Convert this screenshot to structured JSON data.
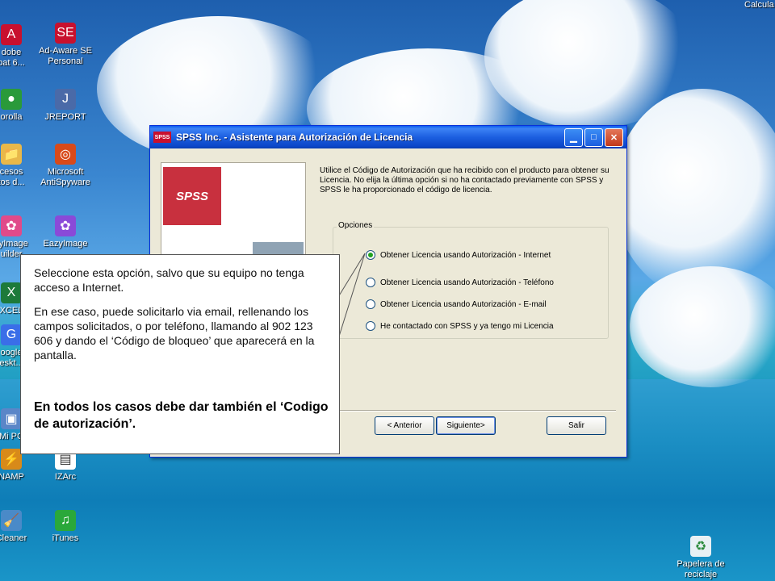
{
  "desktop": {
    "top_right_label": "Calcula",
    "icons_left": [
      {
        "name": "adobe-acrobat-icon",
        "label": "Adobe\nAcrobat 6...",
        "lines": [
          "dobe",
          "bat 6..."
        ],
        "glyph": "A",
        "color": "#c8102e"
      },
      {
        "name": "corolla-icon",
        "lines": [
          "orolla"
        ],
        "glyph": "●",
        "color": "#2a9a3a"
      },
      {
        "name": "accesos-folder-icon",
        "lines": [
          "cesos",
          "tos d..."
        ],
        "glyph": "📁",
        "color": "#e8b84a"
      },
      {
        "name": "eazyimage-builder-icon",
        "lines": [
          "zyImage",
          "uilder"
        ],
        "glyph": "✿",
        "color": "#e04a8a"
      },
      {
        "name": "excel-icon",
        "lines": [
          "XCEL"
        ],
        "glyph": "X",
        "color": "#1d7a3a"
      },
      {
        "name": "google-desktop-icon",
        "lines": [
          "oogle",
          "eskt..."
        ],
        "glyph": "G",
        "color": "#3a6ee8"
      },
      {
        "name": "mi-pc-icon",
        "lines": [
          "Mi PC"
        ],
        "glyph": "▣",
        "color": "#5a86c8"
      },
      {
        "name": "winamp-icon",
        "lines": [
          "NAMP"
        ],
        "glyph": "⚡",
        "color": "#d88a1a"
      },
      {
        "name": "cleaner-icon",
        "lines": [
          "Cleaner"
        ],
        "glyph": "🧹",
        "color": "#4a8ac8"
      }
    ],
    "icons_right": [
      {
        "name": "ad-aware-icon",
        "lines": [
          "Ad-Aware SE",
          "Personal"
        ],
        "glyph": "SE",
        "color": "#c8102e"
      },
      {
        "name": "jreport-icon",
        "lines": [
          "JREPORT"
        ],
        "glyph": "J",
        "color": "#4a6aa8"
      },
      {
        "name": "antispyware-icon",
        "lines": [
          "Microsoft",
          "AntiSpyware"
        ],
        "glyph": "◎",
        "color": "#d84a1a"
      },
      {
        "name": "eazyimage-icon",
        "lines": [
          "EazyImage"
        ],
        "glyph": "✿",
        "color": "#8a4ad8"
      },
      {
        "name": "izarc-icon",
        "lines": [
          "IZArc"
        ],
        "glyph": "▤",
        "color": "#ffffff"
      },
      {
        "name": "itunes-icon",
        "lines": [
          "iTunes"
        ],
        "glyph": "♫",
        "color": "#2aa83a"
      }
    ],
    "recycle_bin": {
      "lines": [
        "Papelera de",
        "reciclaje"
      ]
    }
  },
  "window": {
    "title": "SPSS Inc. - Asistente para Autorización de Licencia",
    "title_icon_text": "SPSS",
    "logo_text": "SPSS",
    "intro_text": "Utilice el Código de Autorización que ha recibido con el producto para obtener su Licencia. No elija la última opción si no ha contactado previamente con SPSS y SPSS le ha proporcionado el código de licencia.",
    "group_label": "Opciones",
    "options": [
      {
        "label": "Obtener Licencia usando Autorización - Internet",
        "selected": true
      },
      {
        "label": "Obtener Licencia usando Autorización - Teléfono",
        "selected": false
      },
      {
        "label": "Obtener Licencia usando Autorización - E-mail",
        "selected": false
      },
      {
        "label": "He contactado con SPSS y ya tengo mi Licencia",
        "selected": false
      }
    ],
    "buttons": {
      "back": "< Anterior",
      "next": "Siguiente>",
      "exit": "Salir"
    }
  },
  "callout": {
    "para1": "Seleccione esta opción, salvo que su equipo no tenga acceso a Internet.",
    "para2": "En ese caso, puede solicitarlo via email, rellenando los campos solicitados, o por teléfono, llamando al 902 123 606 y dando el ‘Código de bloqueo’ que aparecerá en la pantalla.",
    "bold": "En todos los casos debe dar también el ‘Codigo de autorización’."
  }
}
